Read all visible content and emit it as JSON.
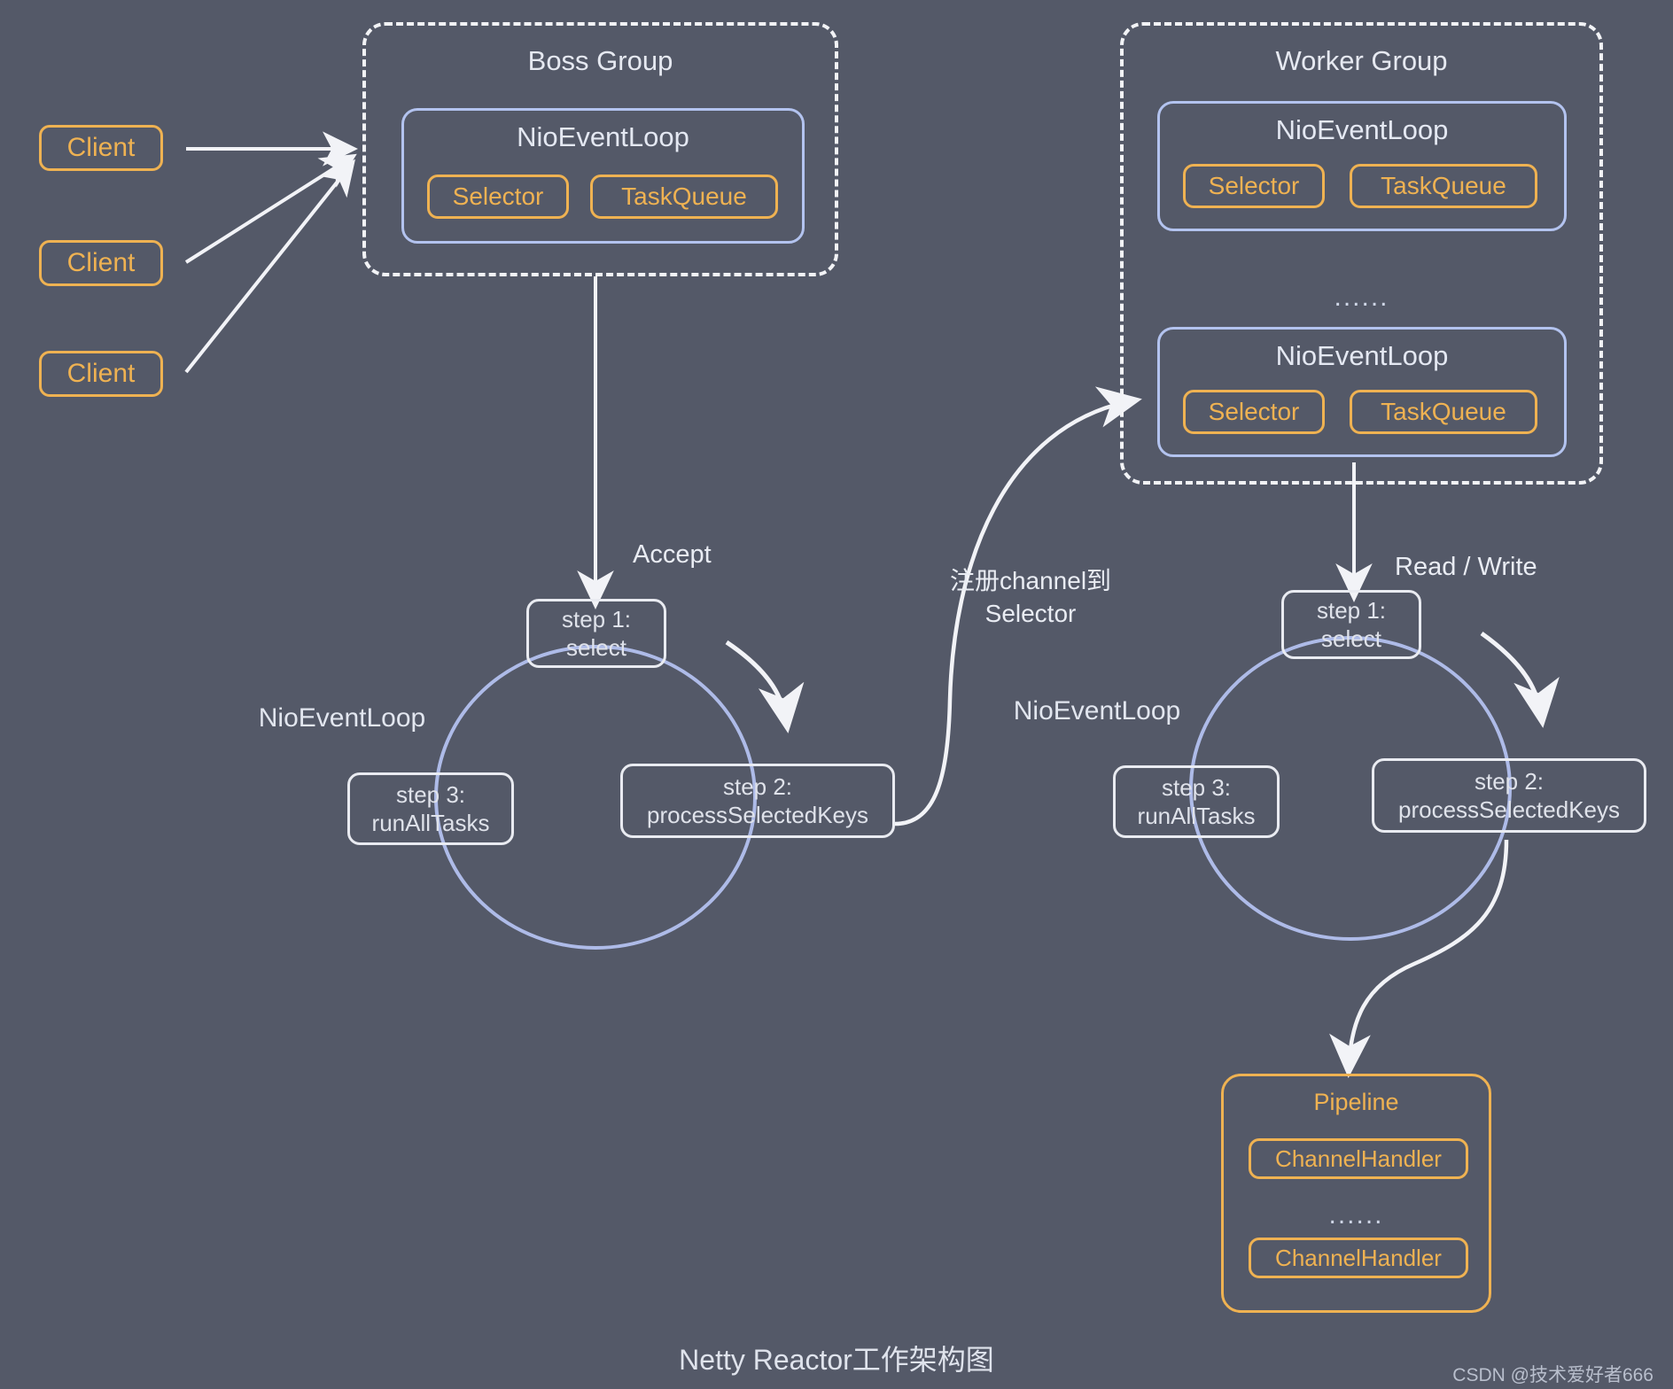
{
  "diagram": {
    "caption": "Netty Reactor工作架构图",
    "watermark": "CSDN @技术爱好者666",
    "colors": {
      "background": "#545968",
      "orange": "#efb252",
      "blue": "#b3c3ef",
      "white": "#e9ebf1"
    }
  },
  "clients": [
    {
      "label": "Client"
    },
    {
      "label": "Client"
    },
    {
      "label": "Client"
    }
  ],
  "boss_group": {
    "title": "Boss Group",
    "event_loop": {
      "title": "NioEventLoop",
      "selector": "Selector",
      "task_queue": "TaskQueue"
    }
  },
  "worker_group": {
    "title": "Worker Group",
    "ellipsis": "......",
    "event_loops": [
      {
        "title": "NioEventLoop",
        "selector": "Selector",
        "task_queue": "TaskQueue"
      },
      {
        "title": "NioEventLoop",
        "selector": "Selector",
        "task_queue": "TaskQueue"
      }
    ]
  },
  "boss_loop": {
    "center_label": "NioEventLoop",
    "edge_label": "Accept",
    "steps": [
      {
        "line1": "step 1:",
        "line2": "select"
      },
      {
        "line1": "step 2:",
        "line2": "processSelectedKeys"
      },
      {
        "line1": "step 3:",
        "line2": "runAllTasks"
      }
    ]
  },
  "worker_loop": {
    "center_label": "NioEventLoop",
    "edge_label": "Read / Write",
    "steps": [
      {
        "line1": "step 1:",
        "line2": "select"
      },
      {
        "line1": "step 2:",
        "line2": "processSelectedKeys"
      },
      {
        "line1": "step 3:",
        "line2": "runAllTasks"
      }
    ]
  },
  "register_label": {
    "line1": "注册channel到",
    "line2": "Selector"
  },
  "pipeline": {
    "title": "Pipeline",
    "ellipsis": "......",
    "handlers": [
      {
        "label": "ChannelHandler"
      },
      {
        "label": "ChannelHandler"
      }
    ]
  }
}
